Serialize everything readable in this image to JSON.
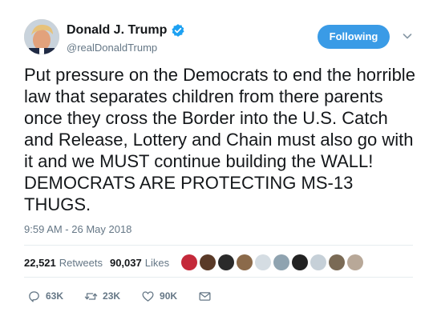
{
  "user": {
    "display_name": "Donald J. Trump",
    "handle": "@realDonaldTrump",
    "verified": true,
    "verified_icon": "verified-badge-icon"
  },
  "follow_button": {
    "label": "Following"
  },
  "menu_icon": "chevron-down-icon",
  "tweet": {
    "text": "Put pressure on the Democrats to end the horrible law that separates children from there parents once they cross the Border into the U.S. Catch and Release, Lottery and Chain must also go with it and we MUST continue building the WALL! DEMOCRATS ARE PROTECTING MS-13 THUGS.",
    "timestamp": "9:59 AM - 26 May 2018"
  },
  "stats": {
    "retweets_count": "22,521",
    "retweets_label": "Retweets",
    "likes_count": "90,037",
    "likes_label": "Likes"
  },
  "actions": {
    "reply_count": "63K",
    "retweet_count": "23K",
    "like_count": "90K"
  },
  "colors": {
    "follow_button": "#3a9be6",
    "verified": "#1da1f2",
    "secondary_text": "#657786"
  }
}
